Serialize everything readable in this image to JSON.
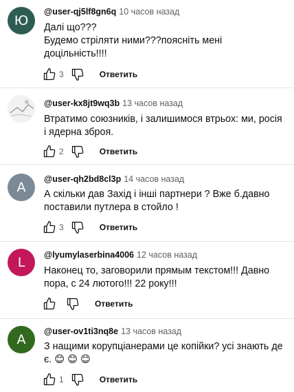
{
  "reply_label": "Ответить",
  "icons": {
    "like": "thumb-up-icon",
    "dislike": "thumb-down-icon"
  },
  "comments": [
    {
      "author": "@user-qj5lf8gn6q",
      "time": "10 часов назад",
      "avatar_letter": "Ю",
      "avatar_color": "#2e5c52",
      "text": "Далі що???\nБудемо стріляти ними???поясніть мені доцільність!!!!",
      "likes": "3"
    },
    {
      "author": "@user-kx8jt9wq3b",
      "time": "13 часов назад",
      "avatar_letter": "",
      "avatar_color": "#eeeeee",
      "text": "Втратимо союзників, і залишимося втрьох: ми, росія і ядерна зброя.",
      "likes": "2"
    },
    {
      "author": "@user-qh2bd8cl3p",
      "time": "14 часов назад",
      "avatar_letter": "A",
      "avatar_color": "#7a8a96",
      "text": "А скільки дав Захід і інші партнери ? Вже б.давно поставили путлера в стойло !",
      "likes": "3"
    },
    {
      "author": "@lyumylaserbina4006",
      "time": "12 часов назад",
      "avatar_letter": "L",
      "avatar_color": "#c2185b",
      "text": "Наконец то, заговорили прямым текстом!!! Давно пора, с 24 лютого!!! 22 року!!!",
      "likes": ""
    },
    {
      "author": "@user-ov1ti3nq8e",
      "time": "13 часов назад",
      "avatar_letter": "A",
      "avatar_color": "#33691e",
      "text": "З нащими корупціанерами це копійки? усі знають де є. 😊 😊 😊",
      "likes": "1"
    }
  ]
}
